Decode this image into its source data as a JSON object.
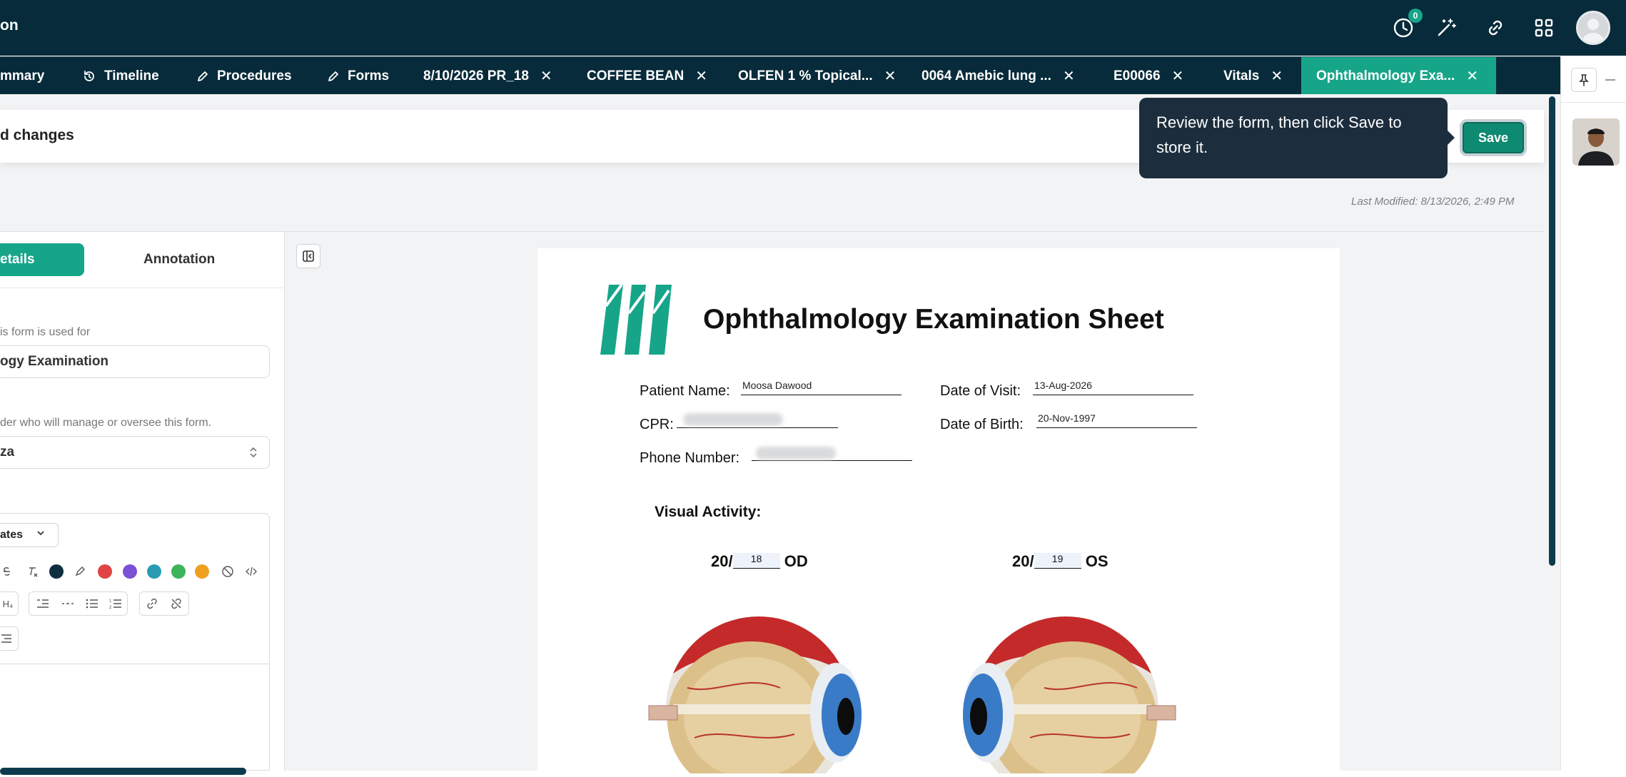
{
  "header": {
    "app_title": "on",
    "notification_count": "0",
    "icons": [
      "clock-icon",
      "magic-wand-icon",
      "link-icon",
      "apps-grid-icon",
      "user-avatar"
    ]
  },
  "tabs": [
    {
      "label": "mmary",
      "icon": "summary-icon",
      "closable": false,
      "active": false
    },
    {
      "label": "Timeline",
      "icon": "history-icon",
      "closable": false,
      "active": false
    },
    {
      "label": "Procedures",
      "icon": "pencil-icon",
      "closable": false,
      "active": false
    },
    {
      "label": "Forms",
      "icon": "pencil-icon",
      "closable": false,
      "active": false
    },
    {
      "label": "8/10/2026 PR_18",
      "closable": true,
      "active": false
    },
    {
      "label": "COFFEE BEAN",
      "closable": true,
      "active": false
    },
    {
      "label": "OLFEN 1 % Topical...",
      "closable": true,
      "active": false
    },
    {
      "label": "0064 Amebic lung ...",
      "closable": true,
      "active": false
    },
    {
      "label": "E00066",
      "closable": true,
      "active": false
    },
    {
      "label": "Vitals",
      "closable": true,
      "active": false
    },
    {
      "label": "Ophthalmology Exa...",
      "closable": true,
      "active": true
    }
  ],
  "tab_close_glyph": "✕",
  "banner": {
    "text": "d changes",
    "save_label": "Save"
  },
  "tooltip": {
    "text": "Review the form, then click Save to store it."
  },
  "last_modified": "Last Modified: 8/13/2026, 2:49 PM",
  "left_panel": {
    "segments": {
      "details": "etails",
      "annotation": "Annotation"
    },
    "purpose_label": "is form is used for",
    "purpose_value": "ogy Examination",
    "owner_label": "der who will manage or oversee this form.",
    "owner_value": "za",
    "templates_label": "ates",
    "toolbar_colors": [
      "#0d2f3f",
      "#e04444",
      "#7b4fd6",
      "#2a9bb3",
      "#3db35a",
      "#f0a020"
    ]
  },
  "document": {
    "title": "Ophthalmology Examination Sheet",
    "patient_name_label": "Patient Name:",
    "patient_name": "Moosa Dawood",
    "date_of_visit_label": "Date of Visit:",
    "date_of_visit": "13-Aug-2026",
    "cpr_label": "CPR:",
    "date_of_birth_label": "Date of Birth:",
    "date_of_birth": "20-Nov-1997",
    "phone_label": "Phone Number:",
    "visual_activity_label": "Visual Activity:",
    "od": {
      "prefix": "20/",
      "value": "18",
      "suffix": "OD"
    },
    "os": {
      "prefix": "20/",
      "value": "19",
      "suffix": "OS"
    }
  },
  "colors": {
    "navy": "#072b3a",
    "accent": "#17a589",
    "tooltip": "#1c2e3d"
  }
}
